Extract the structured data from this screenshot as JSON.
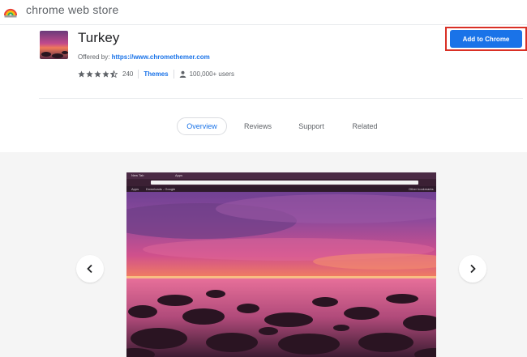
{
  "store": {
    "title": "chrome web store",
    "logo_icon": "chrome-web-store-rainbow-icon"
  },
  "item": {
    "title": "Turkey",
    "offered_by_label": "Offered by:",
    "offered_by_link": "https://www.chromethemer.com",
    "rating": 4.5,
    "rating_count": "240",
    "category": "Themes",
    "users": "100,000+ users",
    "add_button_label": "Add to Chrome"
  },
  "tabs": [
    {
      "label": "Overview",
      "active": true
    },
    {
      "label": "Reviews",
      "active": false
    },
    {
      "label": "Support",
      "active": false
    },
    {
      "label": "Related",
      "active": false
    }
  ],
  "preview": {
    "tab_label_1": "New Tab",
    "tab_label_2": "Apps",
    "bookmark_apps": "Apps",
    "bookmark_downloads": "Downloads - Google",
    "bookmark_other": "Other bookmarks"
  },
  "colors": {
    "accent": "#1a73e8",
    "highlight_outline": "#d93025"
  }
}
